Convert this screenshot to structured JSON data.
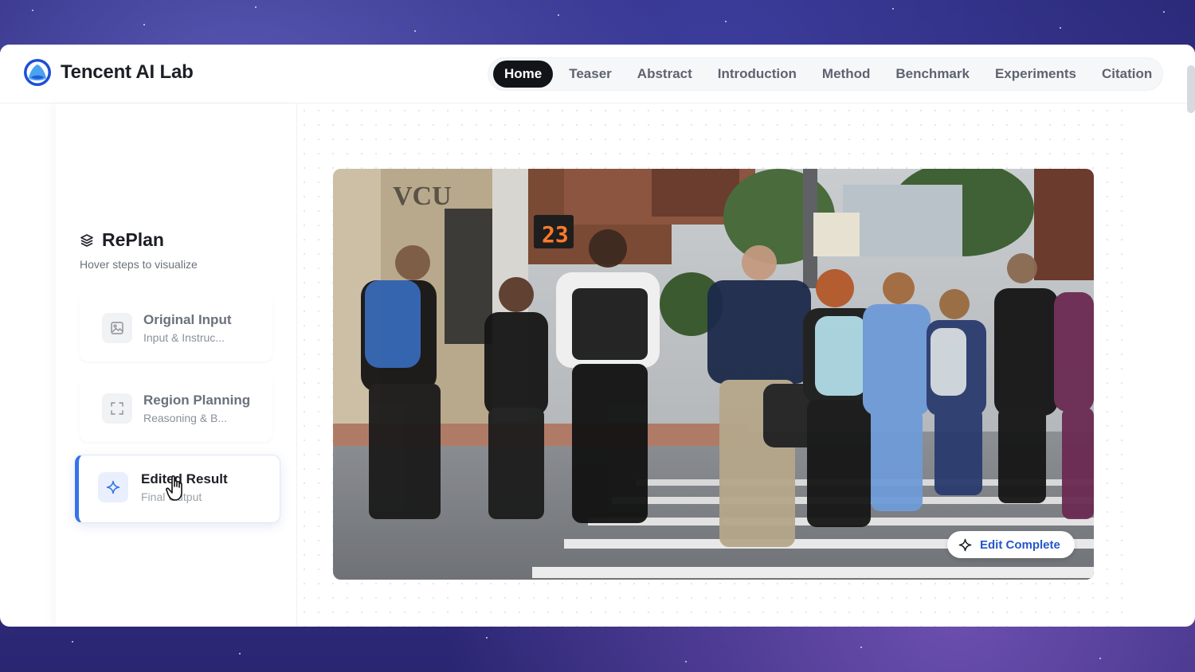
{
  "brand": {
    "name": "Tencent AI Lab",
    "logo_icon": "tencent-ai-lab-logo"
  },
  "nav": {
    "items": [
      {
        "label": "Home",
        "active": true
      },
      {
        "label": "Teaser"
      },
      {
        "label": "Abstract"
      },
      {
        "label": "Introduction"
      },
      {
        "label": "Method"
      },
      {
        "label": "Benchmark"
      },
      {
        "label": "Experiments"
      },
      {
        "label": "Citation"
      }
    ]
  },
  "sidebar": {
    "title": "RePlan",
    "title_icon": "layers-icon",
    "subtitle": "Hover steps to visualize",
    "steps": [
      {
        "title": "Original Input",
        "desc": "Input & Instruc...",
        "icon": "image-icon"
      },
      {
        "title": "Region Planning",
        "desc": "Reasoning & B...",
        "icon": "scan-frame-icon"
      },
      {
        "title": "Edited Result",
        "desc": "Final Output",
        "icon": "sparkle-icon",
        "active": true
      }
    ]
  },
  "main": {
    "image_alt": "People crossing a street at a crosswalk",
    "pedestrian_signal_count": "23",
    "badge": {
      "label": "Edit Complete",
      "icon": "sparkle-icon"
    }
  },
  "colors": {
    "accent": "#3574e8",
    "badge_text": "#2458c8",
    "nav_active_bg": "#111418"
  }
}
